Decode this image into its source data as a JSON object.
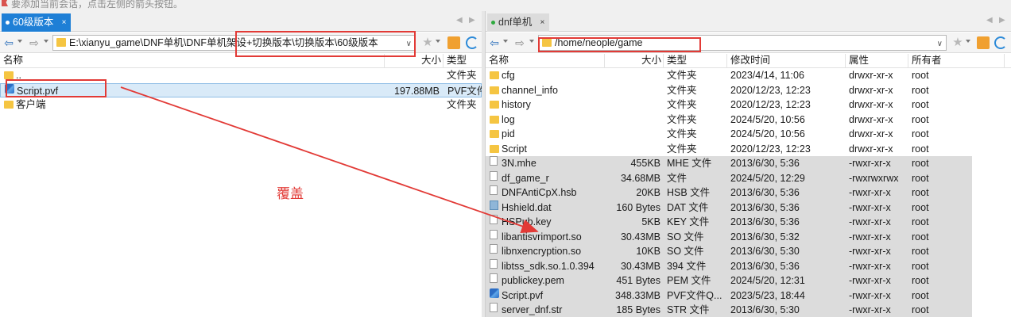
{
  "hint": {
    "text": "要添加当前会话，点击左侧的箭头按钮。"
  },
  "left": {
    "tab": "60级版本",
    "close": "×",
    "path": "E:\\xianyu_game\\DNF单机\\DNF单机架设+切换版本\\切换版本\\60级版本",
    "headers": {
      "name": "名称",
      "size": "大小",
      "type": "类型"
    },
    "rows": [
      {
        "name": "..",
        "size": "",
        "type": "文件夹",
        "icon": "up-folder-icon"
      },
      {
        "name": "Script.pvf",
        "size": "197.88MB",
        "type": "PVF文件",
        "icon": "pvf-file-icon",
        "selected": true
      },
      {
        "name": "客户端",
        "size": "",
        "type": "文件夹",
        "icon": "folder-icon"
      }
    ]
  },
  "right": {
    "tab": "dnf单机",
    "close": "×",
    "path": "/home/neople/game",
    "headers": {
      "name": "名称",
      "size": "大小",
      "type": "类型",
      "modified": "修改时间",
      "attr": "属性",
      "owner": "所有者"
    },
    "rows": [
      {
        "name": "cfg",
        "size": "",
        "type": "文件夹",
        "modified": "2023/4/14, 11:06",
        "attr": "drwxr-xr-x",
        "owner": "root",
        "icon": "folder-icon"
      },
      {
        "name": "channel_info",
        "size": "",
        "type": "文件夹",
        "modified": "2020/12/23, 12:23",
        "attr": "drwxr-xr-x",
        "owner": "root",
        "icon": "folder-icon"
      },
      {
        "name": "history",
        "size": "",
        "type": "文件夹",
        "modified": "2020/12/23, 12:23",
        "attr": "drwxr-xr-x",
        "owner": "root",
        "icon": "folder-icon"
      },
      {
        "name": "log",
        "size": "",
        "type": "文件夹",
        "modified": "2024/5/20, 10:56",
        "attr": "drwxr-xr-x",
        "owner": "root",
        "icon": "folder-icon"
      },
      {
        "name": "pid",
        "size": "",
        "type": "文件夹",
        "modified": "2024/5/20, 10:56",
        "attr": "drwxr-xr-x",
        "owner": "root",
        "icon": "folder-icon"
      },
      {
        "name": "Script",
        "size": "",
        "type": "文件夹",
        "modified": "2020/12/23, 12:23",
        "attr": "drwxr-xr-x",
        "owner": "root",
        "icon": "folder-icon"
      },
      {
        "name": "3N.mhe",
        "size": "455KB",
        "type": "MHE 文件",
        "modified": "2013/6/30, 5:36",
        "attr": "-rwxr-xr-x",
        "owner": "root",
        "icon": "file-icon",
        "gray": true
      },
      {
        "name": "df_game_r",
        "size": "34.68MB",
        "type": "文件",
        "modified": "2024/5/20, 12:29",
        "attr": "-rwxrwxrwx",
        "owner": "root",
        "icon": "file-icon",
        "gray": true
      },
      {
        "name": "DNFAntiCpX.hsb",
        "size": "20KB",
        "type": "HSB 文件",
        "modified": "2013/6/30, 5:36",
        "attr": "-rwxr-xr-x",
        "owner": "root",
        "icon": "file-icon",
        "gray": true
      },
      {
        "name": "Hshield.dat",
        "size": "160 Bytes",
        "type": "DAT 文件",
        "modified": "2013/6/30, 5:36",
        "attr": "-rwxr-xr-x",
        "owner": "root",
        "icon": "dat-file-icon",
        "gray": true
      },
      {
        "name": "HSPub.key",
        "size": "5KB",
        "type": "KEY 文件",
        "modified": "2013/6/30, 5:36",
        "attr": "-rwxr-xr-x",
        "owner": "root",
        "icon": "file-icon",
        "gray": true
      },
      {
        "name": "libantisvrimport.so",
        "size": "30.43MB",
        "type": "SO 文件",
        "modified": "2013/6/30, 5:32",
        "attr": "-rwxr-xr-x",
        "owner": "root",
        "icon": "file-icon",
        "gray": true
      },
      {
        "name": "libnxencryption.so",
        "size": "10KB",
        "type": "SO 文件",
        "modified": "2013/6/30, 5:30",
        "attr": "-rwxr-xr-x",
        "owner": "root",
        "icon": "file-icon",
        "gray": true
      },
      {
        "name": "libtss_sdk.so.1.0.394",
        "size": "30.43MB",
        "type": "394 文件",
        "modified": "2013/6/30, 5:36",
        "attr": "-rwxr-xr-x",
        "owner": "root",
        "icon": "file-icon",
        "gray": true
      },
      {
        "name": "publickey.pem",
        "size": "451 Bytes",
        "type": "PEM 文件",
        "modified": "2024/5/20, 12:31",
        "attr": "-rwxr-xr-x",
        "owner": "root",
        "icon": "file-icon",
        "gray": true
      },
      {
        "name": "Script.pvf",
        "size": "348.33MB",
        "type": "PVF文件Q...",
        "modified": "2023/5/23, 18:44",
        "attr": "-rwxr-xr-x",
        "owner": "root",
        "icon": "pvf-file-icon",
        "gray": true
      },
      {
        "name": "server_dnf.str",
        "size": "185 Bytes",
        "type": "STR 文件",
        "modified": "2013/6/30, 5:30",
        "attr": "-rwxr-xr-x",
        "owner": "root",
        "icon": "file-icon",
        "gray": true
      }
    ]
  },
  "annotation": {
    "text": "覆盖",
    "color": "#e23a36"
  },
  "colors": {
    "accent": "#1e7fd6",
    "selection": "#d9eaf8",
    "highlight_gray": "#dcdcdc",
    "annotation_red": "#e23a36"
  }
}
